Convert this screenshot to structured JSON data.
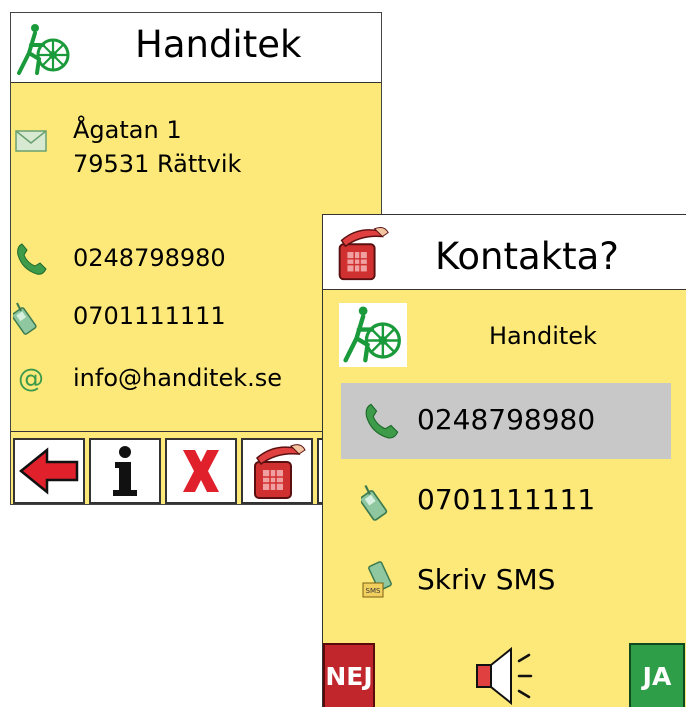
{
  "contact_screen": {
    "title": "Handitek",
    "logo": "handitek-logo",
    "address_line1": "Ågatan 1",
    "address_line2": "79531 Rättvik",
    "phone": "0248798980",
    "mobile": "0701111111",
    "email": "info@handitek.se",
    "toolbar": {
      "buttons": [
        {
          "name": "back-button",
          "icon": "red-arrow-left-icon"
        },
        {
          "name": "info-button",
          "icon": "info-icon"
        },
        {
          "name": "delete-button",
          "icon": "red-x-icon"
        },
        {
          "name": "call-button",
          "icon": "red-phone-icon"
        },
        {
          "name": "more-button",
          "icon": "partially-hidden-icon"
        }
      ]
    }
  },
  "contact_dialog": {
    "title": "Kontakta?",
    "header_icon": "red-phone-icon",
    "contact_name": "Handitek",
    "options": [
      {
        "label": "0248798980",
        "icon": "green-phone-icon",
        "selected": true
      },
      {
        "label": "0701111111",
        "icon": "mobile-phone-icon",
        "selected": false
      },
      {
        "label": "Skriv SMS",
        "icon": "sms-icon",
        "selected": false
      }
    ],
    "no_label": "NEJ",
    "yes_label": "JA",
    "speaker_icon": "speaker-icon",
    "colors": {
      "background": "#fde97a",
      "selected": "#c8c8c8",
      "no": "#c0262c",
      "yes": "#2f9e48"
    }
  }
}
